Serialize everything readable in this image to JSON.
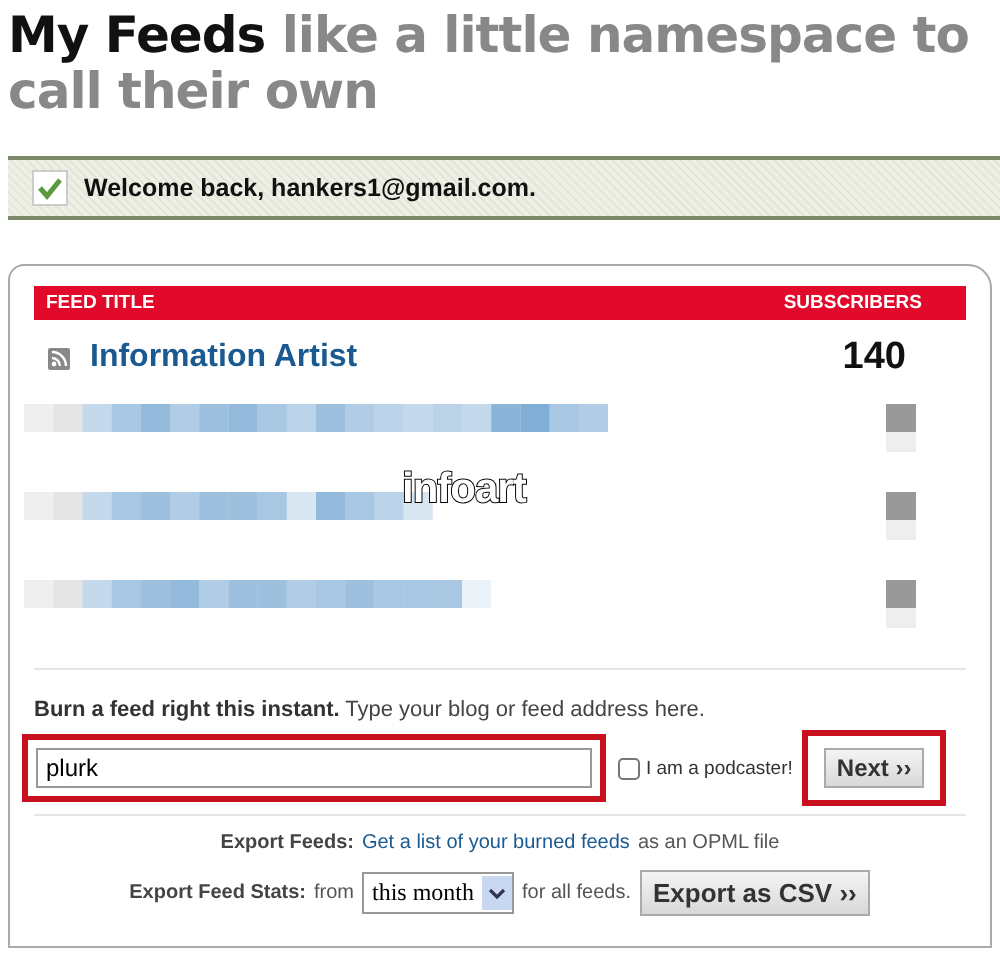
{
  "heading": {
    "title": "My Feeds",
    "tagline": "like a little namespace to call their own"
  },
  "notice": {
    "text": "Welcome back, hankers1@gmail.com."
  },
  "table": {
    "columns": [
      "FEED TITLE",
      "SUBSCRIBERS"
    ],
    "rows": [
      {
        "kind": "feed",
        "title": "Information Artist",
        "subscribers": "140"
      },
      {
        "kind": "redacted"
      },
      {
        "kind": "redacted"
      },
      {
        "kind": "redacted"
      }
    ]
  },
  "overlay_label": "infoart",
  "burn": {
    "label": "**Burn a feed right this instant.** Type your blog or feed address here.",
    "value": "plurk",
    "podcaster": {
      "label": "I am a podcaster!",
      "checked": false
    },
    "button": "Next ››"
  },
  "export_feeds": {
    "label": "Export Feeds:",
    "link": "Get a list of your burned feeds",
    "suffix": "as an OPML file"
  },
  "export_stats": {
    "label": "Export Feed Stats:",
    "from": "from",
    "period": "this month",
    "suffix": "for all feeds.",
    "button": "Export as CSV ››"
  }
}
